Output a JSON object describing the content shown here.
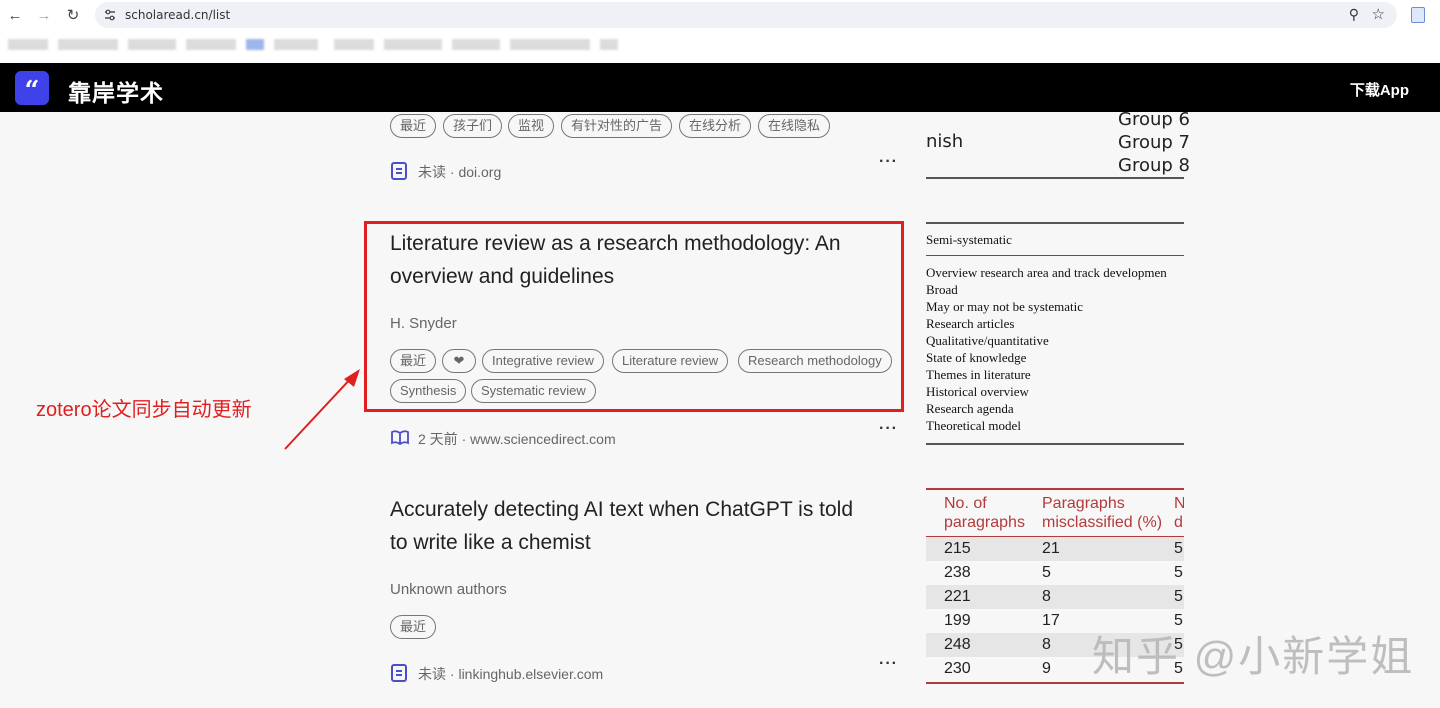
{
  "browser": {
    "url": "scholaread.cn/list"
  },
  "app": {
    "brand": "靠岸学术",
    "download_label": "下载App"
  },
  "list": {
    "item0": {
      "tags": [
        "最近",
        "孩子们",
        "监视",
        "有针对性的广告",
        "在线分析",
        "在线隐私"
      ],
      "status": "未读",
      "source": "doi.org"
    },
    "item1": {
      "title_line1": "Literature review as a research methodology: An",
      "title_line2": "overview and guidelines",
      "authors": "H. Snyder",
      "tags_row1": [
        "最近",
        "Integrative review",
        "Literature review",
        "Research methodology"
      ],
      "tags_row2": [
        "Synthesis",
        "Systematic review"
      ],
      "status": "2 天前",
      "source": "www.sciencedirect.com"
    },
    "item2": {
      "title_line1": "Accurately detecting AI text when ChatGPT is told",
      "title_line2": "to write like a chemist",
      "authors": "Unknown authors",
      "tags": [
        "最近"
      ],
      "status": "未读",
      "source": "linkinghub.elsevier.com"
    },
    "more_label": "···",
    "separator": "·"
  },
  "annotation": {
    "text": "zotero论文同步自动更新",
    "color": "#e02020"
  },
  "preview": {
    "groups": [
      "Group 6",
      "Group 7",
      "Group 8"
    ],
    "fragment": "nish",
    "table_header": "Semi-systematic",
    "table_rows": [
      "Overview research area and track developmen",
      "Broad",
      "May or may not be systematic",
      "Research articles",
      "Qualitative/quantitative",
      "State of knowledge",
      "Themes in literature",
      "Historical overview",
      "Research agenda",
      "Theoretical model"
    ],
    "red_table": {
      "headers": [
        "No. of\nparagraphs",
        "Paragraphs\nmisclassified (%)",
        "N\nd"
      ],
      "rows": [
        [
          "215",
          "21",
          "5"
        ],
        [
          "238",
          "5",
          "5"
        ],
        [
          "221",
          "8",
          "5"
        ],
        [
          "199",
          "17",
          "5"
        ],
        [
          "248",
          "8",
          "5"
        ],
        [
          "230",
          "9",
          "5"
        ]
      ]
    }
  },
  "watermark": "知乎 @小新学姐",
  "colors": {
    "accent": "#3e42e8",
    "highlight": "#e02020",
    "table_accent": "#b33a3a"
  }
}
